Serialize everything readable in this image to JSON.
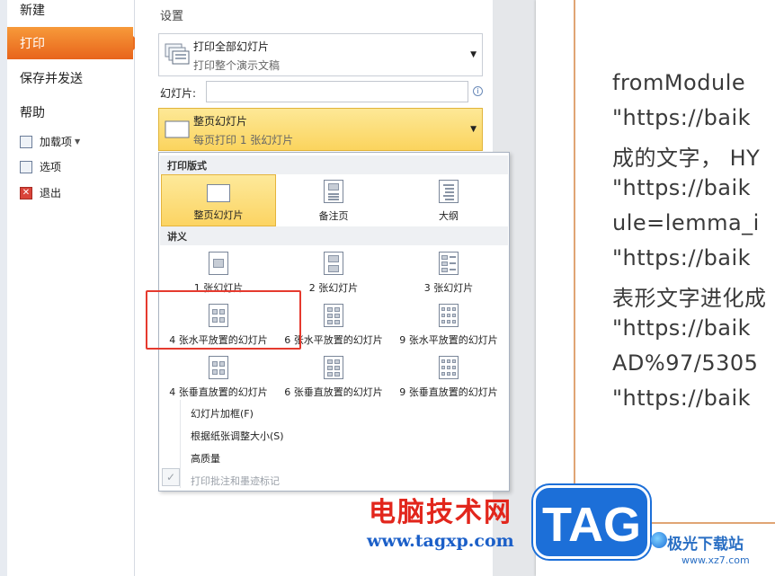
{
  "nav": {
    "new": "新建",
    "print": "打印",
    "save_send": "保存并发送",
    "help": "帮助",
    "addins": "加载项",
    "options": "选项",
    "exit": "退出"
  },
  "settings": {
    "title": "设置",
    "print_range": {
      "main": "打印全部幻灯片",
      "sub": "打印整个演示文稿"
    },
    "slides_label": "幻灯片:",
    "slides_value": "",
    "layout": {
      "main": "整页幻灯片",
      "sub": "每页打印 1 张幻灯片"
    }
  },
  "gallery": {
    "print_layout_header": "打印版式",
    "layouts": [
      "整页幻灯片",
      "备注页",
      "大纲"
    ],
    "handouts_header": "讲义",
    "handouts": [
      "1 张幻灯片",
      "2 张幻灯片",
      "3 张幻灯片",
      "4 张水平放置的幻灯片",
      "6 张水平放置的幻灯片",
      "9 张水平放置的幻灯片",
      "4 张垂直放置的幻灯片",
      "6 张垂直放置的幻灯片",
      "9 张垂直放置的幻灯片"
    ],
    "options": [
      "幻灯片加框(F)",
      "根据纸张调整大小(S)",
      "高质量",
      "打印批注和墨迹标记"
    ]
  },
  "preview": {
    "lines": [
      "fromModule",
      "\"https://baik",
      "成的文字， HY",
      "\"https://baik",
      "ule=lemma_i",
      "\"https://baik",
      "表形文字进化成",
      "\"https://baik",
      "AD%97/5305",
      "\"https://baik"
    ]
  },
  "watermark": {
    "cn": "电脑技术网",
    "url": "www.tagxp.com",
    "tag": "TAG",
    "jg": "极光下载站",
    "jg_url": "www.xz7.com"
  },
  "colors": {
    "accent": "#e8641b",
    "highlight": "#fbd45e",
    "annotation": "#e53a2e"
  }
}
